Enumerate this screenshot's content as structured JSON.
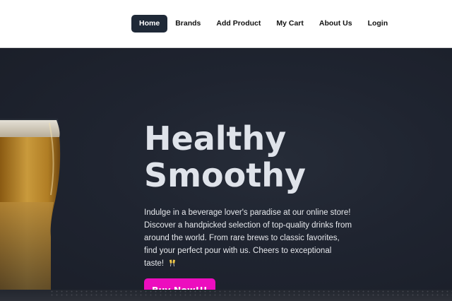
{
  "nav": {
    "items": [
      {
        "label": "Home",
        "active": true
      },
      {
        "label": "Brands",
        "active": false
      },
      {
        "label": "Add Product",
        "active": false
      },
      {
        "label": "My Cart",
        "active": false
      },
      {
        "label": "About Us",
        "active": false
      },
      {
        "label": "Login",
        "active": false
      }
    ]
  },
  "hero": {
    "title_line1": "Healthy",
    "title_line2": "Smoothy",
    "description": "Indulge in a beverage lover's paradise at our online store! Discover a handpicked selection of top-quality drinks from around the world. From rare brews to classic favorites, find your perfect pour with us. Cheers to exceptional taste!",
    "cta_label": "Buy Now!!!"
  },
  "colors": {
    "nav_active_bg": "#1f2937",
    "hero_bg": "#1f2430",
    "cta_bg": "#ec0dbe"
  },
  "icons": {
    "description_end": "clinking-glasses-icon"
  }
}
